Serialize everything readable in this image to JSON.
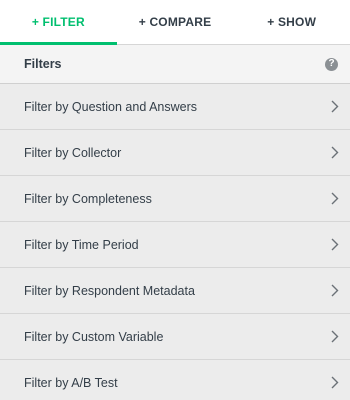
{
  "tabs": [
    {
      "label": "+ FILTER",
      "active": true
    },
    {
      "label": "+ COMPARE",
      "active": false
    },
    {
      "label": "+ SHOW",
      "active": false
    }
  ],
  "header": {
    "title": "Filters",
    "help_icon": "help-icon",
    "help_glyph": "?"
  },
  "filters": [
    {
      "label": "Filter by Question and Answers"
    },
    {
      "label": "Filter by Collector"
    },
    {
      "label": "Filter by Completeness"
    },
    {
      "label": "Filter by Time Period"
    },
    {
      "label": "Filter by Respondent Metadata"
    },
    {
      "label": "Filter by Custom Variable"
    },
    {
      "label": "Filter by A/B Test"
    }
  ],
  "colors": {
    "accent": "#00bf6f",
    "text": "#333e48",
    "background": "#ececec",
    "chevron": "#6b7177"
  }
}
